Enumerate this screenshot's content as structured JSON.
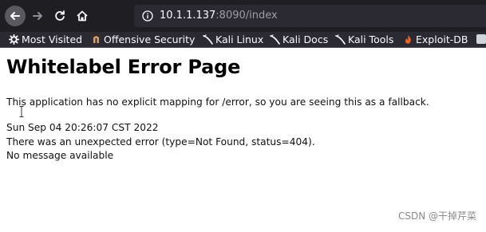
{
  "browser": {
    "url": {
      "host": "10.1.1.137",
      "rest": ":8090/index"
    },
    "colors": {
      "toolbar_bg": "#1f1e23",
      "urlbar_bg": "#2b2a33",
      "bookmarks_bg": "#2b2a33",
      "text_light": "#fbfbfe",
      "text_dim": "#9e9da5"
    }
  },
  "bookmarks": {
    "items": [
      {
        "label": "Most Visited",
        "icon": "gear-icon"
      },
      {
        "label": "Offensive Security",
        "icon": "offsec-icon"
      },
      {
        "label": "Kali Linux",
        "icon": "kali-dragon-icon"
      },
      {
        "label": "Kali Docs",
        "icon": "kali-dragon-icon"
      },
      {
        "label": "Kali Tools",
        "icon": "kali-dragon-icon"
      },
      {
        "label": "Exploit-DB",
        "icon": "exploitdb-icon"
      }
    ]
  },
  "page": {
    "title": "Whitelabel Error Page",
    "description": "This application has no explicit mapping for /error, so you are seeing this as a fallback.",
    "timestamp": "Sun Sep 04 20:26:07 CST 2022",
    "error_line": "There was an unexpected error (type=Not Found, status=404).",
    "message": "No message available"
  },
  "watermark": {
    "text": "CSDN @干掉芹菜"
  }
}
